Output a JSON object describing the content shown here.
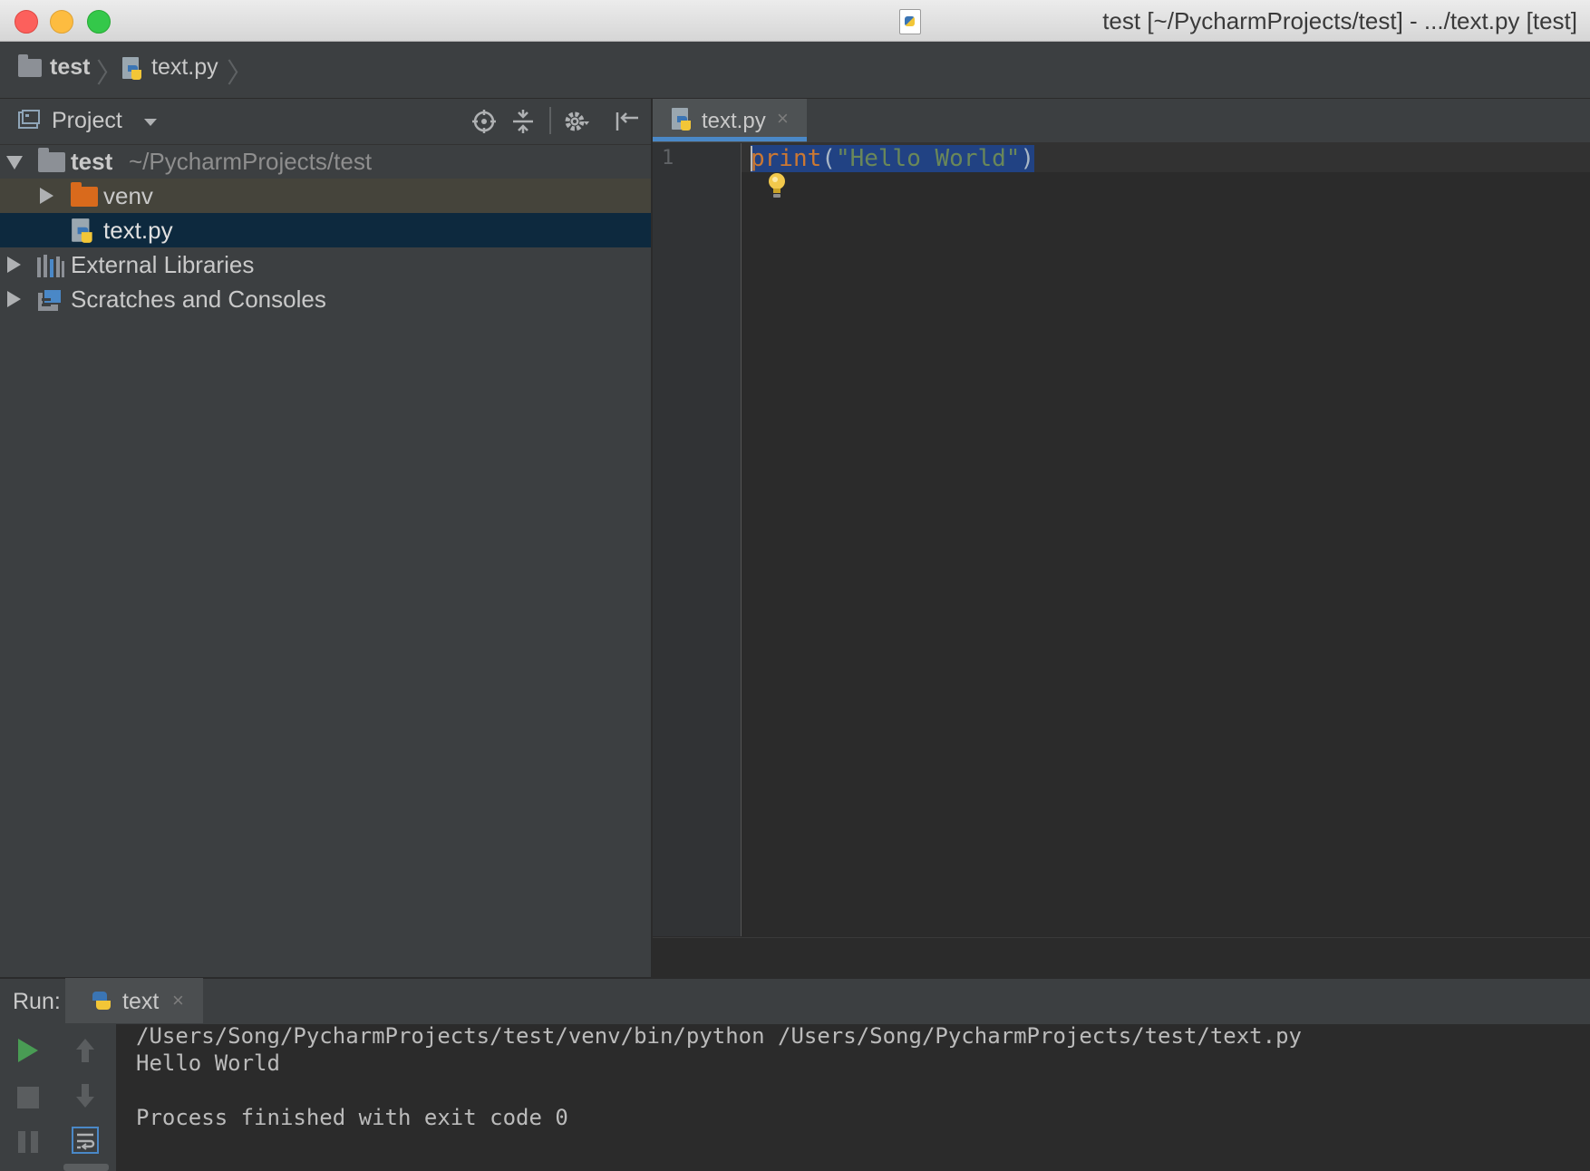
{
  "window": {
    "title": "test [~/PycharmProjects/test] - .../text.py [test]"
  },
  "navbar": {
    "project": "test",
    "separator": "〉",
    "file": "text.py"
  },
  "project_panel": {
    "view_label": "Project",
    "tree": [
      {
        "label": "test",
        "path": "~/PycharmProjects/test",
        "expanded": true,
        "icon": "folder-icon"
      },
      {
        "label": "venv",
        "expanded": false,
        "icon": "folder-excluded-icon"
      },
      {
        "label": "text.py",
        "selected": true,
        "icon": "python-file-icon"
      },
      {
        "label": "External Libraries",
        "expanded": false,
        "icon": "libraries-icon"
      },
      {
        "label": "Scratches and Consoles",
        "expanded": false,
        "icon": "scratches-icon"
      }
    ]
  },
  "editor": {
    "tab_label": "text.py",
    "tab_close": "×",
    "line_number": "1",
    "code": {
      "keyword": "print",
      "open_paren": "(",
      "string": "\"Hello World\"",
      "close_paren": ")"
    }
  },
  "run": {
    "label": "Run:",
    "tab_label": "text",
    "tab_close": "×",
    "output": [
      "/Users/Song/PycharmProjects/test/venv/bin/python /Users/Song/PycharmProjects/test/text.py",
      "Hello World",
      "",
      "Process finished with exit code 0"
    ]
  },
  "colors": {
    "accent": "#4a88c7",
    "selection": "#0d293e",
    "keyword": "#cc7832",
    "string": "#6a8759",
    "run_green": "#499c54"
  }
}
